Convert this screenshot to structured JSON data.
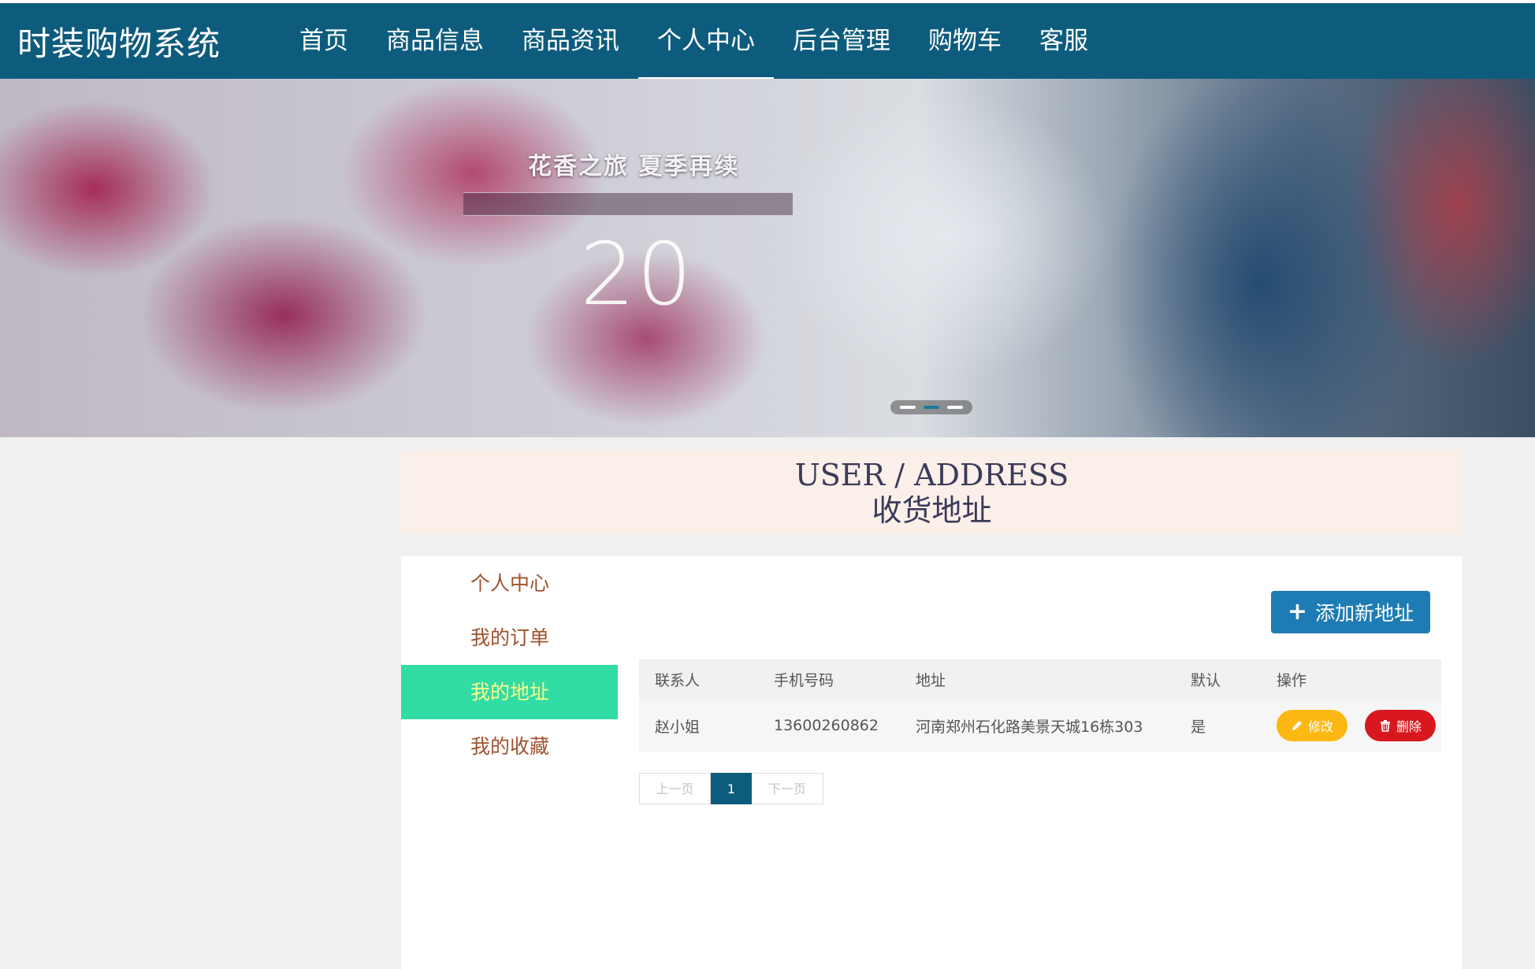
{
  "brand": "时装购物系统",
  "nav": {
    "items": [
      {
        "label": "首页"
      },
      {
        "label": "商品信息"
      },
      {
        "label": "商品资讯"
      },
      {
        "label": "个人中心",
        "active": true
      },
      {
        "label": "后台管理"
      },
      {
        "label": "购物车"
      },
      {
        "label": "客服"
      }
    ]
  },
  "banner": {
    "title": "花香之旅 夏季再续",
    "number": "20",
    "carousel": {
      "slides": 3,
      "active_index": 1
    }
  },
  "header": {
    "title_en": "USER / ADDRESS",
    "title_cn": "收货地址"
  },
  "sidebar": {
    "items": [
      {
        "label": "个人中心"
      },
      {
        "label": "我的订单"
      },
      {
        "label": "我的地址",
        "active": true
      },
      {
        "label": "我的收藏"
      }
    ]
  },
  "actions": {
    "add_label": "添加新地址",
    "add_icon": "plus-icon"
  },
  "table": {
    "headers": [
      "联系人",
      "手机号码",
      "地址",
      "默认",
      "操作"
    ],
    "rows": [
      {
        "name": "赵小姐",
        "phone": "13600260862",
        "address": "河南郑州石化路美景天城16栋303",
        "default": "是",
        "edit_label": "修改",
        "delete_label": "删除"
      }
    ]
  },
  "pager": {
    "prev": "上一页",
    "current": "1",
    "next": "下一页"
  },
  "colors": {
    "nav_bg": "#0e5c7d",
    "active_sidebar": "#31dca5",
    "add_button": "#1e7cb4",
    "edit_button": "#fdb813",
    "delete_button": "#d9171e"
  }
}
